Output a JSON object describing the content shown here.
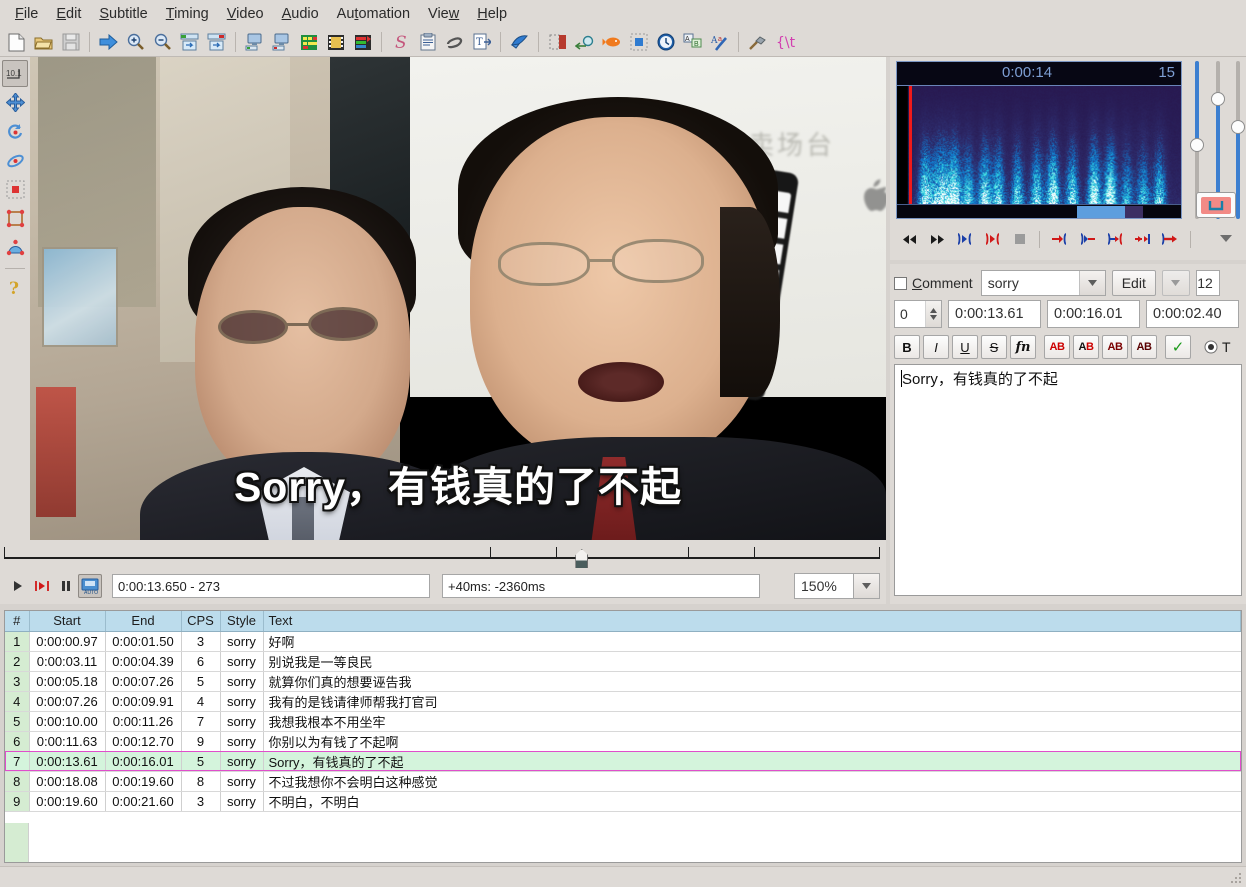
{
  "app": {
    "title": "Aegisub"
  },
  "menubar": {
    "items": [
      {
        "label": "File",
        "accel": "F"
      },
      {
        "label": "Edit",
        "accel": "E"
      },
      {
        "label": "Subtitle",
        "accel": "S"
      },
      {
        "label": "Timing",
        "accel": "T"
      },
      {
        "label": "Video",
        "accel": "V"
      },
      {
        "label": "Audio",
        "accel": "A"
      },
      {
        "label": "Automation",
        "accel": "t"
      },
      {
        "label": "View",
        "accel": "w"
      },
      {
        "label": "Help",
        "accel": "H"
      }
    ]
  },
  "toolbar": {
    "groups": [
      [
        "new-document-icon",
        "open-folder-icon",
        "save-disk-icon"
      ],
      [
        "jump-to-icon",
        "zoom-in-icon",
        "zoom-out-icon",
        "shift-start-icon",
        "shift-end-icon"
      ],
      [
        "attach-video-icon",
        "detach-video-icon",
        "open-subtitles-icon",
        "open-video-icon",
        "open-timecodes-icon"
      ],
      [
        "styles-manager-icon",
        "properties-icon",
        "attachments-icon",
        "fonts-collector-icon"
      ],
      [
        "resample-icon"
      ],
      [
        "select-lines-icon",
        "shift-times-icon",
        "timing-postprocessor-icon",
        "kanji-timer-icon",
        "timing-icon",
        "translation-assistant-icon",
        "styling-assistant-icon"
      ],
      [
        "automation-icon",
        "karaoke-icon"
      ]
    ]
  },
  "video_tools": {
    "items": [
      {
        "name": "standard-tool",
        "selected": true
      },
      {
        "name": "drag-tool",
        "selected": false
      },
      {
        "name": "rotate-z-tool",
        "selected": false
      },
      {
        "name": "rotate-xy-tool",
        "selected": false
      },
      {
        "name": "scale-tool",
        "selected": false
      },
      {
        "name": "clip-tool",
        "selected": false
      },
      {
        "name": "vector-clip-tool",
        "selected": false
      },
      {
        "name": "help-tool",
        "selected": false
      }
    ]
  },
  "video": {
    "subtitle_overlay": "Sorry，有钱真的了不起",
    "slide_text": "高清卖场台",
    "seek_position_pct": 66.2,
    "controls": {
      "play_icon": "play-icon",
      "play_line_icon": "play-line-icon",
      "pause_icon": "pause-icon",
      "autoscroll_icon": "auto-scroll-icon",
      "position_value": "0:00:13.650 - 273",
      "offset_value": "+40ms: -2360ms",
      "zoom_value": "150%",
      "zoom_arrow_icon": "chevron-down-icon"
    }
  },
  "audio": {
    "ruler": {
      "center_label": "0:00:14",
      "right_label": "15"
    },
    "transport": [
      {
        "name": "play-before-selection-icon"
      },
      {
        "name": "play-after-selection-icon"
      },
      {
        "name": "play-selection-icon"
      },
      {
        "name": "play-to-end-icon"
      },
      {
        "name": "stop-icon"
      },
      {
        "name": "commit-start-icon"
      },
      {
        "name": "commit-end-icon"
      },
      {
        "name": "goto-prev-icon"
      },
      {
        "name": "goto-next-icon"
      },
      {
        "name": "next-line-icon"
      },
      {
        "name": "options-menu-icon"
      }
    ],
    "sliders": [
      {
        "name": "horizontal-zoom-slider",
        "value_pct": 46
      },
      {
        "name": "vertical-zoom-slider",
        "value_pct": 75
      },
      {
        "name": "volume-slider",
        "value_pct": 59
      }
    ],
    "loop_button_icon": "loop-selection-icon"
  },
  "edit_box": {
    "comment_label": "Comment",
    "comment_accel": "C",
    "comment_checked": false,
    "style_value": "sorry",
    "edit_button": "Edit",
    "actor_arrow_icon": "chevron-down-icon",
    "layer_or_margin_value": "12",
    "layer_value": "0",
    "start_time": "0:00:13.61",
    "end_time": "0:00:16.01",
    "duration": "0:00:02.40",
    "format_buttons": [
      {
        "name": "bold-button",
        "label": "B"
      },
      {
        "name": "italic-button",
        "label": "I"
      },
      {
        "name": "underline-button",
        "label": "U"
      },
      {
        "name": "strikeout-button",
        "label": "S"
      },
      {
        "name": "font-button",
        "label": "fn"
      },
      {
        "name": "primary-color-button",
        "label": "AB"
      },
      {
        "name": "secondary-color-button",
        "label": "AB"
      },
      {
        "name": "outline-color-button",
        "label": "AB"
      },
      {
        "name": "shadow-color-button",
        "label": "AB"
      },
      {
        "name": "commit-button",
        "label": "✓"
      }
    ],
    "time_mode_icon": "radio-selected-icon",
    "time_mode_label": "T",
    "text": "Sorry，有钱真的了不起"
  },
  "grid": {
    "columns": [
      "#",
      "Start",
      "End",
      "CPS",
      "Style",
      "Text"
    ],
    "rows": [
      {
        "num": "1",
        "start": "0:00:00.97",
        "end": "0:00:01.50",
        "cps": "3",
        "style": "sorry",
        "text": "好啊",
        "selected": false
      },
      {
        "num": "2",
        "start": "0:00:03.11",
        "end": "0:00:04.39",
        "cps": "6",
        "style": "sorry",
        "text": "别说我是一等良民",
        "selected": false
      },
      {
        "num": "3",
        "start": "0:00:05.18",
        "end": "0:00:07.26",
        "cps": "5",
        "style": "sorry",
        "text": "就算你们真的想要诬告我",
        "selected": false
      },
      {
        "num": "4",
        "start": "0:00:07.26",
        "end": "0:00:09.91",
        "cps": "4",
        "style": "sorry",
        "text": "我有的是钱请律师帮我打官司",
        "selected": false
      },
      {
        "num": "5",
        "start": "0:00:10.00",
        "end": "0:00:11.26",
        "cps": "7",
        "style": "sorry",
        "text": "我想我根本不用坐牢",
        "selected": false
      },
      {
        "num": "6",
        "start": "0:00:11.63",
        "end": "0:00:12.70",
        "cps": "9",
        "style": "sorry",
        "text": "你别以为有钱了不起啊",
        "selected": false
      },
      {
        "num": "7",
        "start": "0:00:13.61",
        "end": "0:00:16.01",
        "cps": "5",
        "style": "sorry",
        "text": "Sorry，有钱真的了不起",
        "selected": true
      },
      {
        "num": "8",
        "start": "0:00:18.08",
        "end": "0:00:19.60",
        "cps": "8",
        "style": "sorry",
        "text": "不过我想你不会明白这种感觉",
        "selected": false
      },
      {
        "num": "9",
        "start": "0:00:19.60",
        "end": "0:00:21.60",
        "cps": "3",
        "style": "sorry",
        "text": "不明白，不明白",
        "selected": false
      }
    ]
  },
  "colors": {
    "chrome": "#dedad6",
    "grid_header": "#bcdcec",
    "row_number_bg": "#d5ecd2",
    "selected_row_bg": "#d4f4dc",
    "selected_row_border": "#e04ecb",
    "playhead_red": "#f01a1a",
    "slider_blue": "#3c7fd0",
    "loop_pink": "#f28a86"
  }
}
